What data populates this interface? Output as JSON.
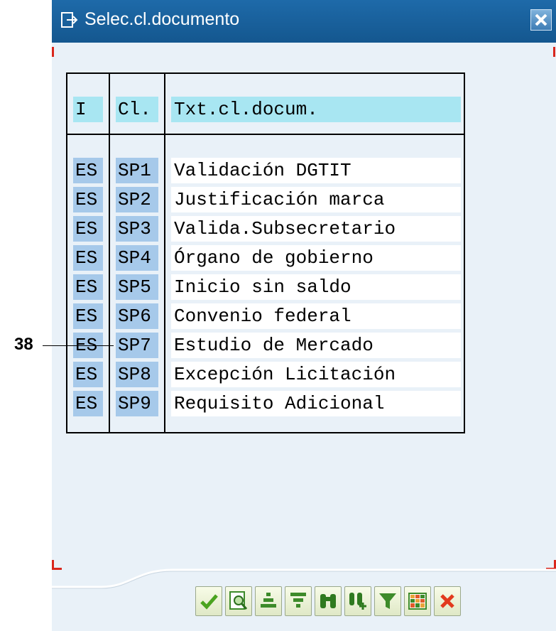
{
  "dialog": {
    "title": "Selec.cl.documento",
    "close_icon": "close-icon"
  },
  "table": {
    "columns": [
      "I",
      "Cl.",
      "Txt.cl.docum."
    ],
    "rows": [
      {
        "lang": "ES",
        "cl": "SP1",
        "text": "Validación DGTIT"
      },
      {
        "lang": "ES",
        "cl": "SP2",
        "text": "Justificación marca"
      },
      {
        "lang": "ES",
        "cl": "SP3",
        "text": "Valida.Subsecretario"
      },
      {
        "lang": "ES",
        "cl": "SP4",
        "text": "Órgano de gobierno"
      },
      {
        "lang": "ES",
        "cl": "SP5",
        "text": "Inicio sin saldo"
      },
      {
        "lang": "ES",
        "cl": "SP6",
        "text": "Convenio federal"
      },
      {
        "lang": "ES",
        "cl": "SP7",
        "text": "Estudio de Mercado"
      },
      {
        "lang": "ES",
        "cl": "SP8",
        "text": "Excepción Licitación"
      },
      {
        "lang": "ES",
        "cl": "SP9",
        "text": "Requisito Adicional"
      }
    ]
  },
  "annotation": {
    "label": "38"
  },
  "toolbar": {
    "buttons": [
      {
        "icon": "checkmark-icon"
      },
      {
        "icon": "preview-icon"
      },
      {
        "icon": "sort-ascending-icon"
      },
      {
        "icon": "sort-descending-icon"
      },
      {
        "icon": "find-icon"
      },
      {
        "icon": "find-next-icon"
      },
      {
        "icon": "filter-icon"
      },
      {
        "icon": "layout-grid-icon"
      },
      {
        "icon": "cancel-icon"
      }
    ]
  },
  "colors": {
    "title_bar": "#1e6aa9",
    "dialog_bg": "#e9f1f8",
    "header_bg": "#a8e6f2",
    "selected_cell_bg": "#a6c9ea",
    "cancel_red": "#e23a1d"
  }
}
